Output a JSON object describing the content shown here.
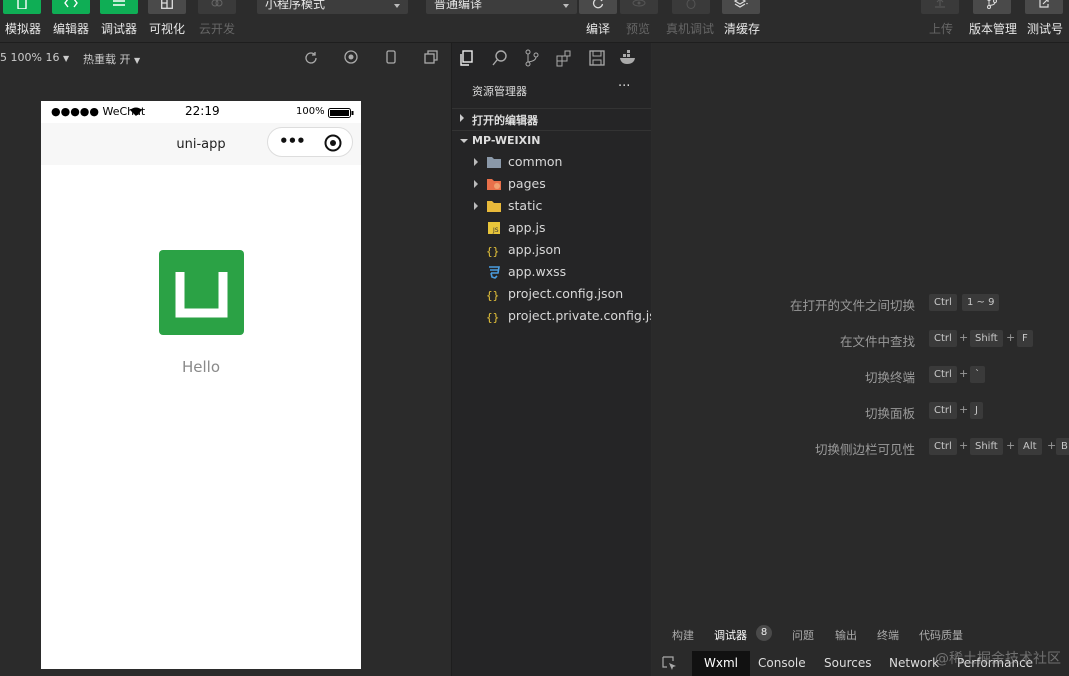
{
  "toolbar": {
    "simulator_label": "模拟器",
    "editor_label": "编辑器",
    "debugger_label": "调试器",
    "visual_label": "可视化",
    "cloud_label": "云开发",
    "mode_select": "小程序模式",
    "compile_select": "普通编译",
    "compile_label": "编译",
    "preview_label": "预览",
    "realdevice_label": "真机调试",
    "clearcache_label": "清缓存",
    "upload_label": "上传",
    "version_label": "版本管理",
    "testid_label": "测试号"
  },
  "simulator": {
    "device_info": "5 100% 16",
    "hotreload": "热重载 开",
    "status": {
      "carrier": "●●●●● WeChat",
      "time": "22:19",
      "battery": "100%"
    },
    "nav_title": "uni-app",
    "capsule_more": "•••",
    "content_text": "Hello"
  },
  "explorer": {
    "title": "资源管理器",
    "more": "···",
    "open_editors": "打开的编辑器",
    "project": "MP-WEIXIN",
    "items": [
      {
        "name": "common",
        "type": "folder"
      },
      {
        "name": "pages",
        "type": "folder-pages"
      },
      {
        "name": "static",
        "type": "folder-static"
      },
      {
        "name": "app.js",
        "type": "js"
      },
      {
        "name": "app.json",
        "type": "json"
      },
      {
        "name": "app.wxss",
        "type": "css"
      },
      {
        "name": "project.config.json",
        "type": "json"
      },
      {
        "name": "project.private.config.js...",
        "type": "json"
      }
    ]
  },
  "editor_hints": [
    {
      "label": "在打开的文件之间切换",
      "keys": [
        "Ctrl",
        "1 ~ 9"
      ]
    },
    {
      "label": "在文件中查找",
      "keys": [
        "Ctrl",
        "Shift",
        "F"
      ]
    },
    {
      "label": "切换终端",
      "keys": [
        "Ctrl",
        "`"
      ]
    },
    {
      "label": "切换面板",
      "keys": [
        "Ctrl",
        "J"
      ]
    },
    {
      "label": "切换侧边栏可见性",
      "keys": [
        "Ctrl",
        "Shift",
        "Alt",
        "B"
      ]
    }
  ],
  "bottom_panel": {
    "tabs": [
      "构建",
      "调试器",
      "问题",
      "输出",
      "终端",
      "代码质量"
    ],
    "debugger_badge": "8",
    "devtools_tabs": [
      "Wxml",
      "Console",
      "Sources",
      "Network",
      "Performance"
    ],
    "watermark": "@稀土掘金技术社区"
  },
  "colors": {
    "accent_green": "#0fae55",
    "logo_green": "#2ba245"
  }
}
